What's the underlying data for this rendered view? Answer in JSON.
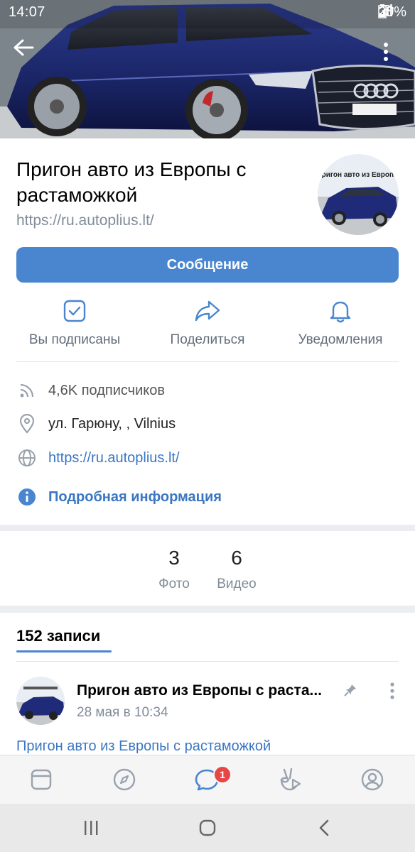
{
  "status_bar": {
    "time": "14:07",
    "battery": "20%"
  },
  "cover": {
    "image": "car-cover-photo"
  },
  "group": {
    "title": "Пригон авто из Европы с растаможкой",
    "url": "https://ru.autoplius.lt/",
    "avatar_text": "Пригон авто из Европы"
  },
  "message_button": "Сообщение",
  "actions": [
    {
      "icon": "checkbox-icon",
      "label": "Вы подписаны"
    },
    {
      "icon": "share-icon",
      "label": "Поделиться"
    },
    {
      "icon": "bell-icon",
      "label": "Уведомления"
    }
  ],
  "info": {
    "subscribers": "4,6K подписчиков",
    "address": "ул. Гарюну, , Vilnius",
    "website": "https://ru.autoplius.lt/",
    "details": "Подробная информация"
  },
  "media": {
    "photos": {
      "count": "3",
      "label": "Фото"
    },
    "videos": {
      "count": "6",
      "label": "Видео"
    }
  },
  "posts": {
    "tab_label": "152 записи",
    "items": [
      {
        "author": "Пригон авто из Европы с раста...",
        "date": "28 мая в 10:34",
        "text": "Пригон авто из Европы с растаможкой"
      }
    ]
  },
  "tabbar": {
    "items": [
      "news-icon",
      "discover-icon",
      "messages-icon",
      "services-icon",
      "profile-icon"
    ],
    "messages_badge": "1",
    "accent": "#4a86cf"
  },
  "colors": {
    "accent": "#4a86cf",
    "link": "#3a76c2",
    "badge": "#e64646"
  }
}
